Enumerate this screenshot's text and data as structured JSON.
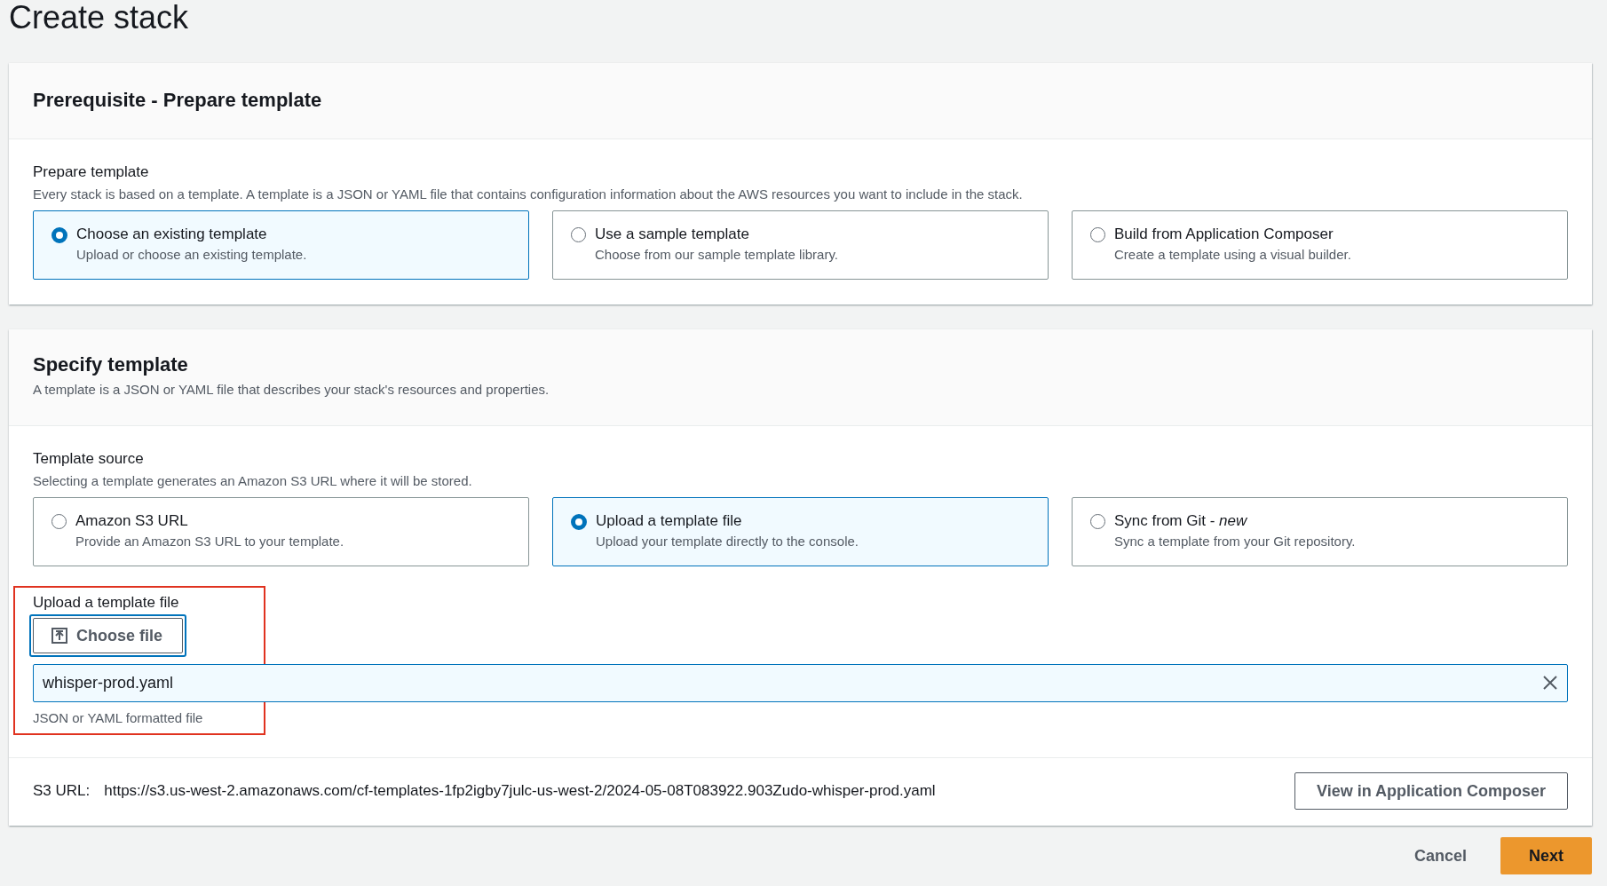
{
  "page": {
    "title": "Create stack"
  },
  "prerequisite": {
    "title": "Prerequisite - Prepare template",
    "field": {
      "label": "Prepare template",
      "description": "Every stack is based on a template. A template is a JSON or YAML file that contains configuration information about the AWS resources you want to include in the stack."
    },
    "options": [
      {
        "label": "Choose an existing template",
        "description": "Upload or choose an existing template.",
        "selected": true
      },
      {
        "label": "Use a sample template",
        "description": "Choose from our sample template library.",
        "selected": false
      },
      {
        "label": "Build from Application Composer",
        "description": "Create a template using a visual builder.",
        "selected": false
      }
    ]
  },
  "specify": {
    "title": "Specify template",
    "description": "A template is a JSON or YAML file that describes your stack's resources and properties.",
    "source": {
      "label": "Template source",
      "description": "Selecting a template generates an Amazon S3 URL where it will be stored.",
      "options": [
        {
          "label": "Amazon S3 URL",
          "description": "Provide an Amazon S3 URL to your template.",
          "selected": false
        },
        {
          "label": "Upload a template file",
          "description": "Upload your template directly to the console.",
          "selected": true
        },
        {
          "label": "Sync from Git - *new*",
          "description": "Sync a template from your Git repository.",
          "selected": false
        }
      ]
    },
    "upload": {
      "label": "Upload a template file",
      "button": "Choose file",
      "value": "whisper-prod.yaml",
      "hint": "JSON or YAML formatted file"
    },
    "s3_url": {
      "label": "S3 URL:",
      "value": "https://s3.us-west-2.amazonaws.com/cf-templates-1fp2igby7julc-us-west-2/2024-05-08T083922.903Zudo-whisper-prod.yaml"
    },
    "view_button": "View in Application Composer"
  },
  "actions": [
    {
      "label": "Cancel",
      "kind": "link"
    },
    {
      "label": "Next",
      "kind": "primary"
    }
  ]
}
